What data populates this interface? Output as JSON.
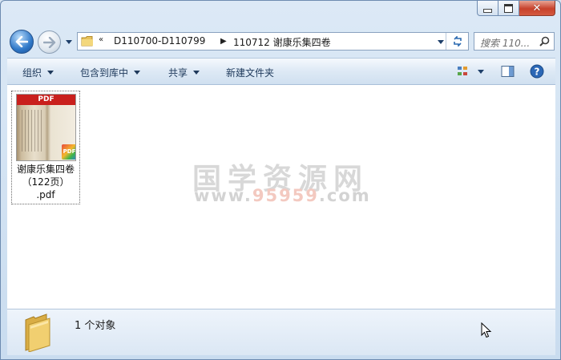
{
  "window": {
    "minimize_label": "minimize",
    "maximize_label": "maximize",
    "close_glyph": "✕"
  },
  "nav": {
    "overflow_glyph": "«",
    "breadcrumbs": [
      "D110700-D110799",
      "110712 谢康乐集四卷"
    ],
    "search_placeholder": "搜索 110..."
  },
  "toolbar": {
    "organize": "组织",
    "include_in_library": "包含到库中",
    "share": "共享",
    "new_folder": "新建文件夹"
  },
  "files": [
    {
      "name_line1": "谢康乐集四卷",
      "name_line2": "（122页）",
      "name_line3": ".pdf",
      "thumb_band": "PDF",
      "badge": "PDF"
    }
  ],
  "watermark": {
    "cn": "国学资源网",
    "url_prefix": "www.",
    "url_highlight": "95959",
    "url_suffix": ".com"
  },
  "status": {
    "object_count": "1 个对象"
  },
  "colors": {
    "accent": "#2f78c8",
    "close_red": "#c7412c",
    "pdf_band": "#c9201d"
  }
}
